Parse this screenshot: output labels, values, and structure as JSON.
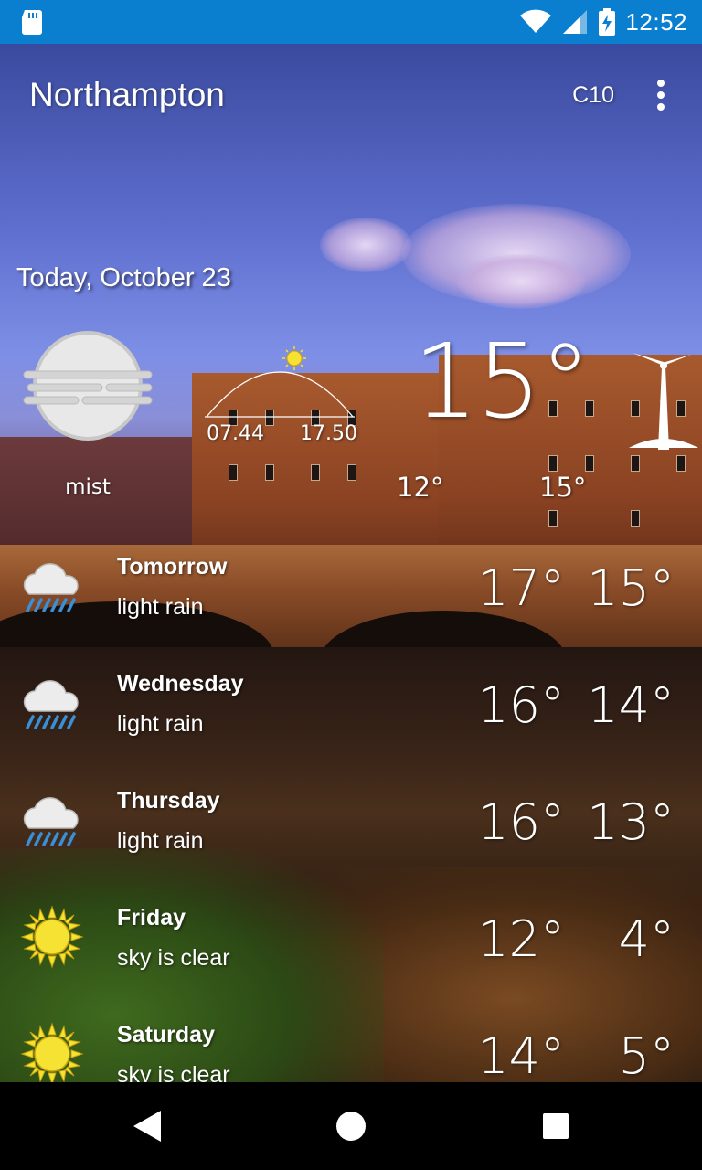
{
  "status_bar": {
    "time": "12:52",
    "icons": [
      "sd-card-icon",
      "wifi-icon",
      "signal-icon",
      "battery-charging-icon"
    ]
  },
  "app_bar": {
    "city": "Northampton",
    "units_label": "C10",
    "menu_icon": "more-vert-icon"
  },
  "today": {
    "date": "Today, October 23",
    "condition": "mist",
    "condition_icon": "mist-icon",
    "sunrise": "07.44",
    "sunset": "17.50",
    "temperature": "15°",
    "low": "12°",
    "high": "15°",
    "wind_icon": "wind-turbine-icon"
  },
  "forecast": [
    {
      "day": "Tomorrow",
      "desc": "light rain",
      "hi": "17°",
      "lo": "15°",
      "icon": "rain-cloud-icon"
    },
    {
      "day": "Wednesday",
      "desc": "light rain",
      "hi": "16°",
      "lo": "14°",
      "icon": "rain-cloud-icon"
    },
    {
      "day": "Thursday",
      "desc": "light rain",
      "hi": "16°",
      "lo": "13°",
      "icon": "rain-cloud-icon"
    },
    {
      "day": "Friday",
      "desc": "sky is clear",
      "hi": "12°",
      "lo": "4°",
      "icon": "sun-icon"
    },
    {
      "day": "Saturday",
      "desc": "sky is clear",
      "hi": "14°",
      "lo": "5°",
      "icon": "sun-icon"
    }
  ],
  "colors": {
    "status_bar": "#0a7fcf",
    "sun": "#f5e232",
    "rain": "#3a8fd6"
  },
  "nav_bar": {
    "icons": [
      "back-icon",
      "home-icon",
      "recents-icon"
    ]
  }
}
